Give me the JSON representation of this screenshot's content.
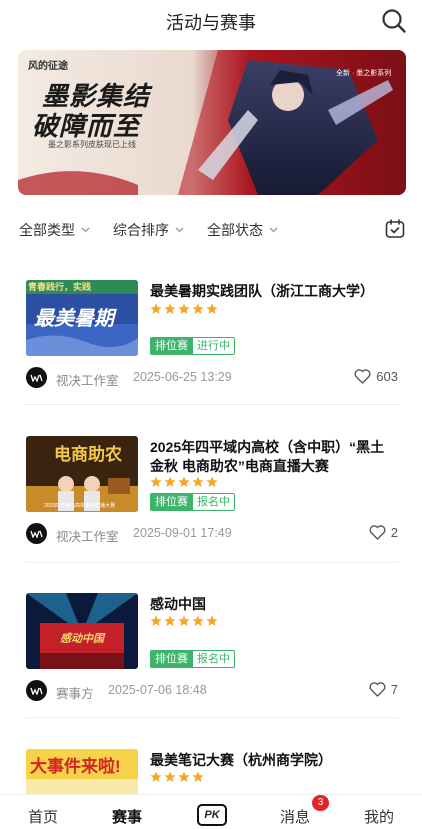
{
  "header": {
    "title": "活动与赛事",
    "search_icon": "search-icon"
  },
  "banner": {
    "logo_text": "风的征途",
    "line1": "墨影集结",
    "line2": "破障而至",
    "subtitle": "墨之影系列皮肤现已上线",
    "side_text": "全新 · 墨之影系列"
  },
  "filters": {
    "type_label": "全部类型",
    "sort_label": "综合排序",
    "status_label": "全部状态",
    "calendar_icon": "calendar-icon"
  },
  "cards": [
    {
      "title": "最美暑期实践团队（浙江工商大学）",
      "stars": 5,
      "type_tag": "排位赛",
      "status_tag": "进行中",
      "author": "视决工作室",
      "datetime": "2025-06-25 13:29",
      "likes": "603",
      "thumb_line1": "青春践行，实践",
      "thumb_big": "最美暑期"
    },
    {
      "title": "2025年四平域内高校（含中职）“黑土金秋 电商助农”电商直播大赛",
      "stars": 5,
      "type_tag": "排位赛",
      "status_tag": "报名中",
      "author": "视决工作室",
      "datetime": "2025-09-01 17:49",
      "likes": "2",
      "thumb_big": "电商助农",
      "thumb_small": "2025四平域内高校电商直播大赛"
    },
    {
      "title": "感动中国",
      "stars": 5,
      "type_tag": "排位赛",
      "status_tag": "报名中",
      "author": "赛事方",
      "datetime": "2025-07-06 18:48",
      "likes": "7",
      "thumb_big": "感动中国"
    },
    {
      "title": "最美笔记大赛（杭州商学院）",
      "stars": 4,
      "thumb_big": "大事件来啦!"
    }
  ],
  "tabbar": {
    "home": "首页",
    "events": "赛事",
    "pk": "PK",
    "messages": "消息",
    "messages_badge": "3",
    "mine": "我的"
  },
  "colors": {
    "accent_green": "#3cb56b",
    "star": "#f5a623",
    "badge_red": "#e3242b"
  }
}
